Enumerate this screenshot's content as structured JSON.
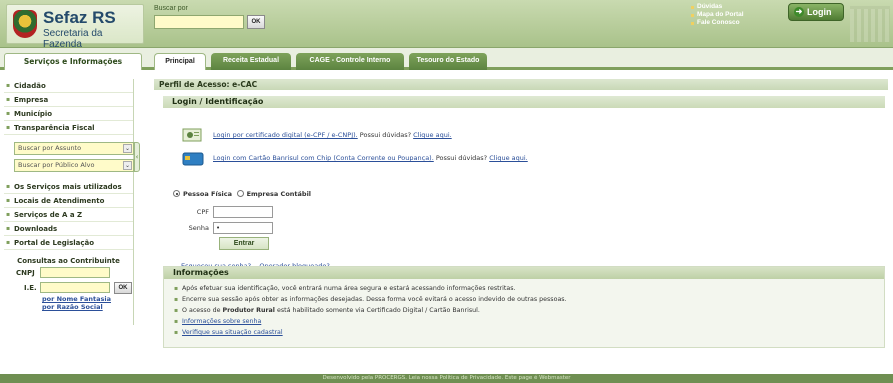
{
  "header": {
    "logo_title": "Sefaz RS",
    "logo_subtitle": "Secretaria da Fazenda",
    "search_label": "Buscar por",
    "search_value": "",
    "search_ok": "OK",
    "top_links": [
      "Dúvidas",
      "Mapa do Portal",
      "Fale Conosco"
    ],
    "login_label": "Login"
  },
  "tabs": {
    "side_tab": "Serviços e Informações",
    "items": [
      "Principal",
      "Receita Estadual",
      "CAGE - Controle Interno",
      "Tesouro do Estado"
    ],
    "active": "Principal"
  },
  "sidebar": {
    "top_links": [
      "Cidadão",
      "Empresa",
      "Município",
      "Transparência Fiscal"
    ],
    "selects": [
      "Buscar por Assunto",
      "Buscar por Público Alvo"
    ],
    "more_links": [
      "Os Serviços mais utilizados",
      "Locais de Atendimento",
      "Serviços de A a Z",
      "Downloads",
      "Portal de Legislação"
    ],
    "consultas_title": "Consultas ao Contribuinte",
    "cnpj_label": "CNPJ",
    "ie_label": "I.E.",
    "ok_label": "OK",
    "name_links": [
      "por Nome Fantasia",
      "por Razão Social"
    ]
  },
  "main": {
    "profile_bar": "Perfil de Acesso: e-CAC",
    "login_heading": "Login / Identificação",
    "cert1_link": "Login por certificado digital (e-CPF / e-CNPJ).",
    "cert1_question": " Possui dúvidas? ",
    "cert1_help": "Clique aqui.",
    "cert2_link": "Login com Cartão Banrisul com Chip (Conta Corrente ou Poupança).",
    "cert2_question": " Possui dúvidas? ",
    "cert2_help": "Clique aqui.",
    "radio_person": "Pessoa Física",
    "radio_company": "Empresa Contábil",
    "cpf_label": "CPF",
    "cpf_value": "",
    "senha_label": "Senha",
    "senha_value": "•",
    "enter_label": "Entrar",
    "forgot_link": "Esqueceu sua senha?",
    "blocked_link": "Operador bloqueado?",
    "info_heading": "Informações",
    "info_items": [
      "Após efetuar sua identificação, você entrará numa área segura e estará acessando informações restritas.",
      "Encerre sua sessão após obter as informações desejadas. Dessa forma você evitará o acesso indevido de outras pessoas."
    ],
    "info_item3_pre": "O acesso de ",
    "info_item3_bold": "Produtor Rural",
    "info_item3_post": " está habilitado somente via Certificado Digital / Cartão Banrisul.",
    "info_links": [
      "Informações sobre senha",
      "Verifique sua situação cadastral"
    ]
  },
  "footer": {
    "text": "Desenvolvido pela PROCERGS. Leia nossa Política de Privacidade. Este page é Webmaster"
  },
  "colors": {
    "header_green": "#a9c28a",
    "tab_green": "#5c8340",
    "input_yellow": "#fffbc9",
    "link_blue": "#2b4f99"
  }
}
